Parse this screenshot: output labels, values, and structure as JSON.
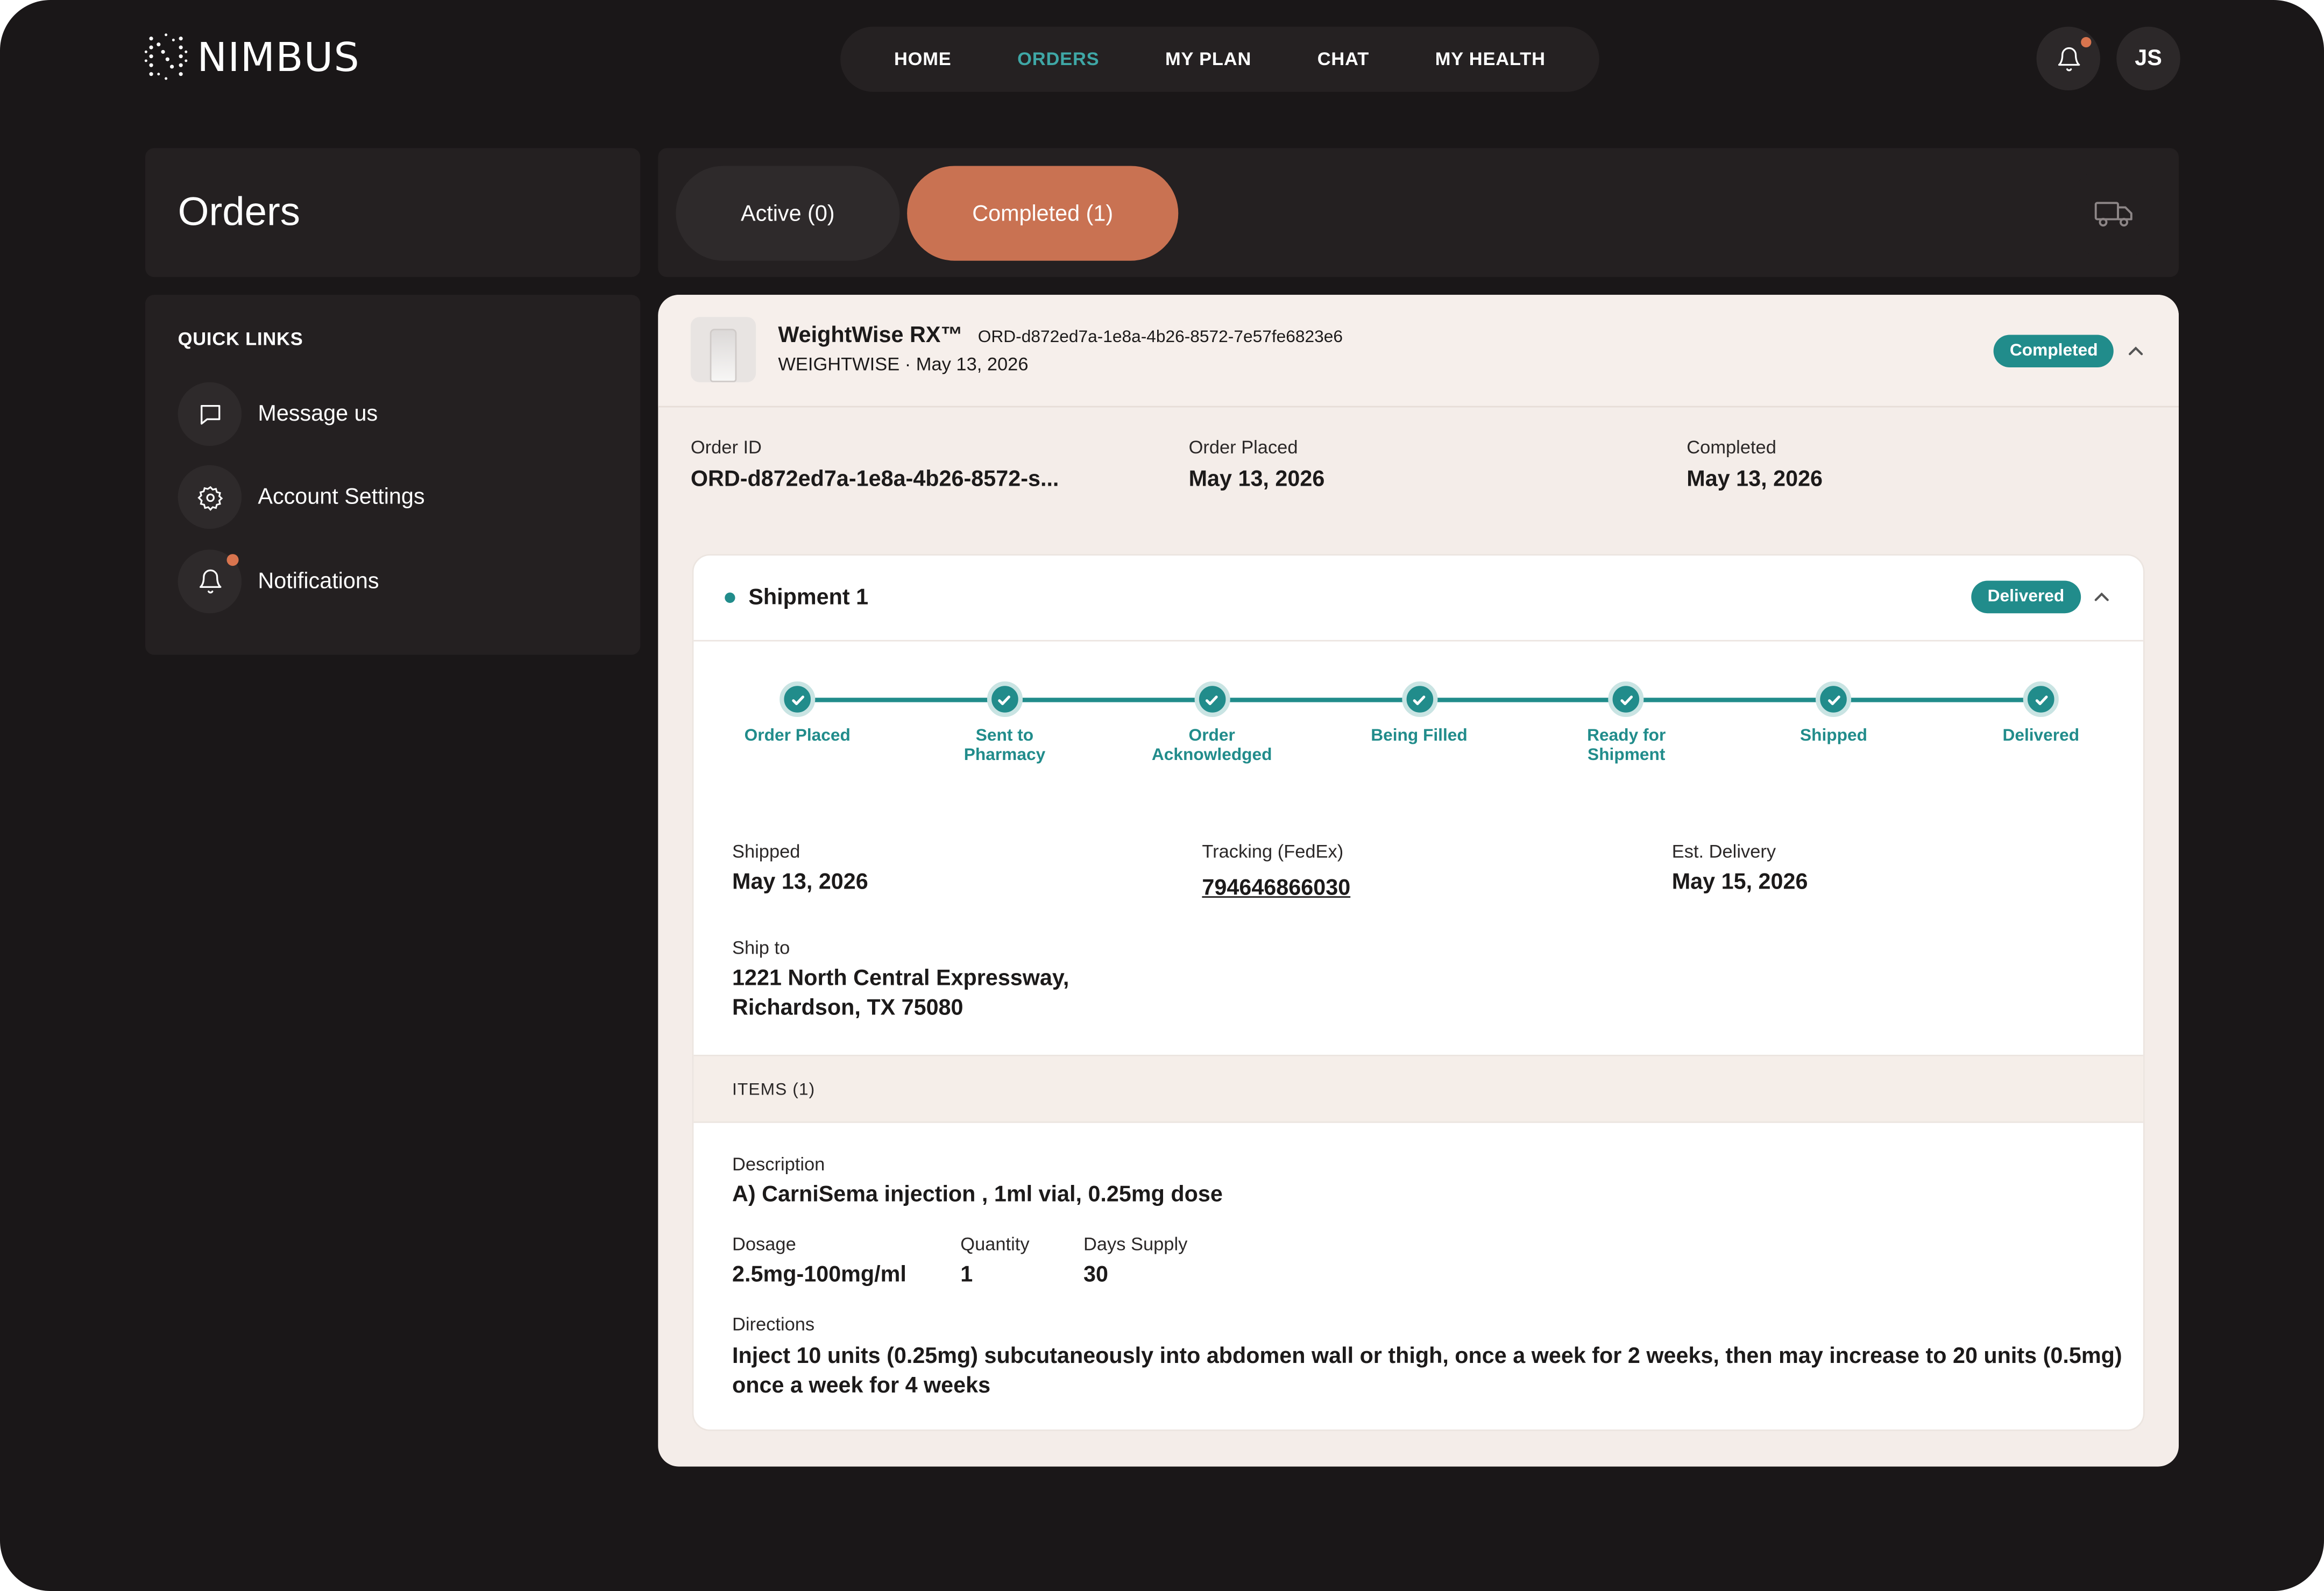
{
  "header": {
    "logo_text": "NIMBUS",
    "nav": [
      "HOME",
      "ORDERS",
      "MY PLAN",
      "CHAT",
      "MY HEALTH"
    ],
    "active_nav": "ORDERS",
    "avatar_initials": "JS"
  },
  "sidebar": {
    "title": "Orders",
    "quick_links_title": "QUICK LINKS",
    "links": [
      {
        "label": "Message us",
        "icon": "chat-bubble-icon"
      },
      {
        "label": "Account Settings",
        "icon": "gear-icon"
      },
      {
        "label": "Notifications",
        "icon": "bell-icon"
      }
    ]
  },
  "tabs": {
    "active": "Active (0)",
    "completed": "Completed (1)"
  },
  "order": {
    "product_name": "WeightWise RX™",
    "order_id_full": "ORD-d872ed7a-1e8a-4b26-8572-7e57fe6823e6",
    "subtitle": "WEIGHTWISE · May 13, 2026",
    "status": "Completed",
    "order_id_label": "Order ID",
    "order_id_truncated": "ORD-d872ed7a-1e8a-4b26-8572-s...",
    "placed_label": "Order Placed",
    "placed_value": "May 13, 2026",
    "completed_label": "Completed",
    "completed_value": "May 13, 2026"
  },
  "shipment": {
    "title": "Shipment 1",
    "status": "Delivered",
    "steps": [
      {
        "line1": "Order Placed",
        "line2": ""
      },
      {
        "line1": "Sent to",
        "line2": "Pharmacy"
      },
      {
        "line1": "Order",
        "line2": "Acknowledged"
      },
      {
        "line1": "Being Filled",
        "line2": ""
      },
      {
        "line1": "Ready for",
        "line2": "Shipment"
      },
      {
        "line1": "Shipped",
        "line2": ""
      },
      {
        "line1": "Delivered",
        "line2": ""
      }
    ],
    "shipped_label": "Shipped",
    "shipped_value": "May 13, 2026",
    "tracking_label": "Tracking (FedEx)",
    "tracking_value": "794646866030",
    "est_label": "Est. Delivery",
    "est_value": "May 15, 2026",
    "ship_to_label": "Ship to",
    "ship_to_line1": "1221 North Central Expressway,",
    "ship_to_line2": "Richardson, TX 75080"
  },
  "items": {
    "header": "ITEMS (1)",
    "description_label": "Description",
    "description_value": "A) CarniSema injection , 1ml vial, 0.25mg dose",
    "dosage_label": "Dosage",
    "dosage_value": "2.5mg-100mg/ml",
    "quantity_label": "Quantity",
    "quantity_value": "1",
    "supply_label": "Days Supply",
    "supply_value": "30",
    "directions_label": "Directions",
    "directions_line1": "Inject 10 units (0.25mg) subcutaneously into abdomen wall or thigh, once a week for 2 weeks, then may increase to 20 units (0.5mg)",
    "directions_line2": "once a week for 4 weeks"
  },
  "colors": {
    "background": "#1a1718",
    "panel": "#242021",
    "accent_teal": "#218c8b",
    "nav_active": "#3fa7a6",
    "accent_orange": "#c97252",
    "card": "#f4ede9"
  }
}
